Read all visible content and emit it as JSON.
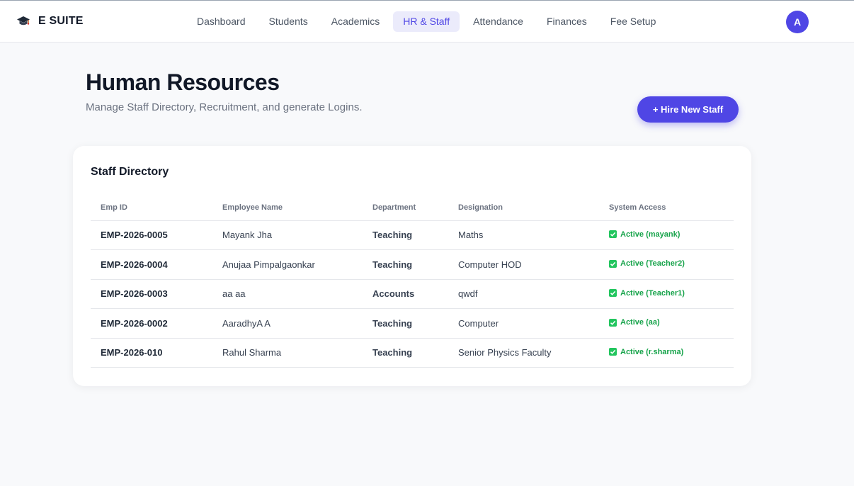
{
  "app": {
    "brand": "E SUITE",
    "brand_icon": "graduation-cap-icon"
  },
  "nav": {
    "items": [
      {
        "label": "Dashboard",
        "active": false
      },
      {
        "label": "Students",
        "active": false
      },
      {
        "label": "Academics",
        "active": false
      },
      {
        "label": "HR & Staff",
        "active": true
      },
      {
        "label": "Attendance",
        "active": false
      },
      {
        "label": "Finances",
        "active": false
      },
      {
        "label": "Fee Setup",
        "active": false
      }
    ],
    "avatar_initial": "A"
  },
  "header": {
    "title": "Human Resources",
    "subtitle": "Manage Staff Directory, Recruitment, and generate Logins.",
    "hire_button_label": "+ Hire New Staff"
  },
  "directory": {
    "title": "Staff Directory",
    "columns": [
      "Emp ID",
      "Employee Name",
      "Department",
      "Designation",
      "System Access"
    ],
    "rows": [
      {
        "emp_id": "EMP-2026-0005",
        "name": "Mayank Jha",
        "department": "Teaching",
        "designation": "Maths",
        "access": "Active (mayank)"
      },
      {
        "emp_id": "EMP-2026-0004",
        "name": "Anujaa Pimpalgaonkar",
        "department": "Teaching",
        "designation": "Computer HOD",
        "access": "Active (Teacher2)"
      },
      {
        "emp_id": "EMP-2026-0003",
        "name": "aa aa",
        "department": "Accounts",
        "designation": "qwdf",
        "access": "Active (Teacher1)"
      },
      {
        "emp_id": "EMP-2026-0002",
        "name": "AaradhyA A",
        "department": "Teaching",
        "designation": "Computer",
        "access": "Active (aa)"
      },
      {
        "emp_id": "EMP-2026-010",
        "name": "Rahul Sharma",
        "department": "Teaching",
        "designation": "Senior Physics Faculty",
        "access": "Active (r.sharma)"
      }
    ]
  },
  "colors": {
    "accent": "#4f46e5",
    "active_nav_bg": "#ebebfb",
    "status_green": "#16a34a",
    "page_bg": "#f8f9fb"
  }
}
